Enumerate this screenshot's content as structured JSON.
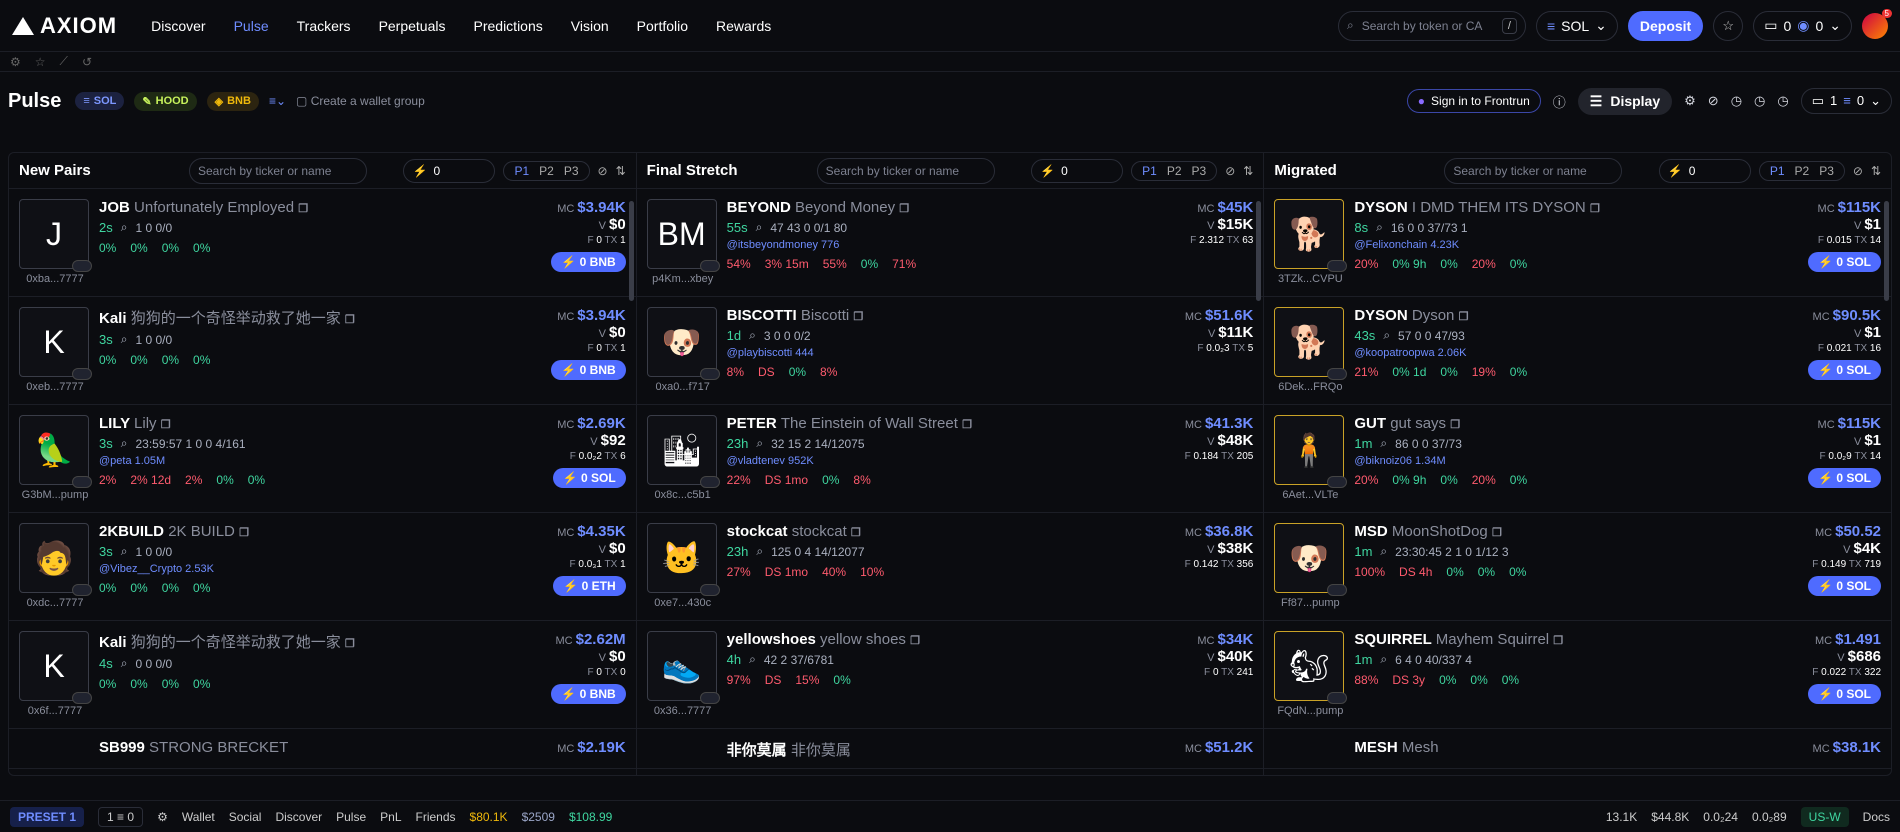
{
  "brand": "AXIOM",
  "nav": [
    "Discover",
    "Pulse",
    "Trackers",
    "Perpetuals",
    "Predictions",
    "Vision",
    "Portfolio",
    "Rewards"
  ],
  "search_placeholder": "Search by token or CA",
  "search_kbd": "/",
  "chain_select": "SOL",
  "deposit": "Deposit",
  "wallet_count": "0",
  "wallet_bal": "0",
  "avatar_badge": "5",
  "pulse": {
    "title": "Pulse",
    "chains": [
      "SOL",
      "HOOD",
      "BNB"
    ],
    "wallet_group": "Create a wallet group",
    "frontrun": "Sign in to Frontrun",
    "display": "Display",
    "wallet_pill_a": "1",
    "wallet_pill_b": "0"
  },
  "columns": [
    {
      "title": "New Pairs",
      "search": "Search by ticker or name",
      "zero": "0",
      "rows": [
        {
          "sym": "JOB",
          "name": "Unfortunately Employed",
          "age": "2s",
          "addr": "0xba...7777",
          "glyph": "J",
          "mc": "$3.94K",
          "v": "$0",
          "f": "0",
          "tx": "1",
          "buy": "0 BNB",
          "stats": [
            "0%",
            "0%",
            "0%",
            "0%"
          ],
          "extra": "1  0  0/0"
        },
        {
          "sym": "Kali",
          "name": "狗狗的一个奇怪举动救了她一家",
          "age": "3s",
          "addr": "0xeb...7777",
          "glyph": "K",
          "mc": "$3.94K",
          "v": "$0",
          "f": "0",
          "tx": "1",
          "buy": "0 BNB",
          "stats": [
            "0%",
            "0%",
            "0%",
            "0%"
          ],
          "extra": "1  0  0/0"
        },
        {
          "sym": "LILY",
          "name": "Lily",
          "age": "3s",
          "addr": "G3bM...pump",
          "glyph": "🦜",
          "mc": "$2.69K",
          "v": "$92",
          "f": "0.0₂2",
          "tx": "6",
          "buy": "0 SOL",
          "stats": [
            "2%",
            "2% 12d",
            "2%",
            "0%",
            "0%"
          ],
          "extra": "23:59:57  1  0  0  4/161",
          "handle": "@peta  1.05M"
        },
        {
          "sym": "2KBUILD",
          "name": "2K BUILD",
          "age": "3s",
          "addr": "0xdc...7777",
          "glyph": "🧑",
          "mc": "$4.35K",
          "v": "$0",
          "f": "0.0₃1",
          "tx": "1",
          "buy": "0 ETH",
          "stats": [
            "0%",
            "0%",
            "0%",
            "0%"
          ],
          "extra": "1  0  0/0",
          "handle": "@Vibez__Crypto  2.53K"
        },
        {
          "sym": "Kali",
          "name": "狗狗的一个奇怪举动救了她一家",
          "age": "4s",
          "addr": "0x6f...7777",
          "glyph": "K",
          "mc": "$2.62M",
          "v": "$0",
          "f": "0",
          "tx": "0",
          "buy": "0 BNB",
          "stats": [
            "0%",
            "0%",
            "0%",
            "0%"
          ],
          "extra": "0  0  0/0"
        }
      ]
    },
    {
      "title": "Final Stretch",
      "search": "Search by ticker or name",
      "zero": "0",
      "rows": [
        {
          "sym": "BEYOND",
          "name": "Beyond Money",
          "age": "55s",
          "addr": "p4Km...xbey",
          "glyph": "BM",
          "mc": "$45K",
          "v": "$15K",
          "f": "2.312",
          "tx": "63",
          "buy": "",
          "stats": [
            "54%",
            "3% 15m",
            "55%",
            "0%",
            "71%"
          ],
          "extra": "47  43  0  0/1  80",
          "handle": "@itsbeyondmoney  776"
        },
        {
          "sym": "BISCOTTI",
          "name": "Biscotti",
          "age": "1d",
          "addr": "0xa0...f717",
          "glyph": "🐶",
          "mc": "$51.6K",
          "v": "$11K",
          "f": "0.0₂3",
          "tx": "5",
          "buy": "",
          "stats": [
            "8%",
            "DS",
            "0%",
            "8%"
          ],
          "extra": "3  0  0  0/2",
          "handle": "@playbiscotti  444"
        },
        {
          "sym": "PETER",
          "name": "The Einstein of Wall Street",
          "age": "23h",
          "addr": "0x8c...c5b1",
          "glyph": "🏙",
          "mc": "$41.3K",
          "v": "$48K",
          "f": "0.184",
          "tx": "205",
          "buy": "",
          "stats": [
            "22%",
            "DS 1mo",
            "0%",
            "8%"
          ],
          "extra": "32  15  2  14/12075",
          "handle": "@vladtenev  952K"
        },
        {
          "sym": "stockcat",
          "name": "stockcat",
          "age": "23h",
          "addr": "0xe7...430c",
          "glyph": "🐱",
          "mc": "$36.8K",
          "v": "$38K",
          "f": "0.142",
          "tx": "356",
          "buy": "",
          "stats": [
            "27%",
            "DS 1mo",
            "40%",
            "10%"
          ],
          "extra": "125  0  4  14/12077"
        },
        {
          "sym": "yellowshoes",
          "name": "yellow shoes",
          "age": "4h",
          "addr": "0x36...7777",
          "glyph": "👟",
          "mc": "$34K",
          "v": "$40K",
          "f": "0",
          "tx": "241",
          "buy": "",
          "stats": [
            "97%",
            "DS",
            "15%",
            "0%"
          ],
          "extra": "42  2  37/6781"
        }
      ]
    },
    {
      "title": "Migrated",
      "search": "Search by ticker or name",
      "zero": "0",
      "rows": [
        {
          "sym": "DYSON",
          "name": "I DMD THEM ITS DYSON",
          "age": "8s",
          "addr": "3TZk...CVPU",
          "glyph": "🐕",
          "mc": "$115K",
          "v": "$1",
          "f": "0.015",
          "tx": "14",
          "buy": "0 SOL",
          "stats": [
            "20%",
            "0% 9h",
            "0%",
            "20%",
            "0%"
          ],
          "extra": "16  0  0  37/73  1",
          "handle": "@Felixonchain  4.23K"
        },
        {
          "sym": "DYSON",
          "name": "Dyson",
          "age": "43s",
          "addr": "6Dek...FRQo",
          "glyph": "🐕",
          "mc": "$90.5K",
          "v": "$1",
          "f": "0.021",
          "tx": "16",
          "buy": "0 SOL",
          "stats": [
            "21%",
            "0% 1d",
            "0%",
            "19%",
            "0%"
          ],
          "extra": "57  0  0  47/93",
          "handle": "@koopatroopwa  2.06K"
        },
        {
          "sym": "GUT",
          "name": "gut says",
          "age": "1m",
          "addr": "6Aet...VLTe",
          "glyph": "🧍",
          "mc": "$115K",
          "v": "$1",
          "f": "0.0₂9",
          "tx": "14",
          "buy": "0 SOL",
          "stats": [
            "20%",
            "0% 9h",
            "0%",
            "20%",
            "0%"
          ],
          "extra": "86  0  0  37/73",
          "handle": "@biknoiz06  1.34M"
        },
        {
          "sym": "MSD",
          "name": "MoonShotDog",
          "age": "1m",
          "addr": "Ff87...pump",
          "glyph": "🐶",
          "mc": "$50.52",
          "v": "$4K",
          "f": "0.149",
          "tx": "719",
          "buy": "0 SOL",
          "stats": [
            "100%",
            "DS 4h",
            "0%",
            "0%",
            "0%"
          ],
          "extra": "23:30:45  2  1  0  1/12  3"
        },
        {
          "sym": "SQUIRREL",
          "name": "Mayhem Squirrel",
          "age": "1m",
          "addr": "FQdN...pump",
          "glyph": "🐿",
          "mc": "$1.491",
          "v": "$686",
          "f": "0.022",
          "tx": "322",
          "buy": "0 SOL",
          "stats": [
            "88%",
            "DS 3y",
            "0%",
            "0%",
            "0%"
          ],
          "extra": "6  4  0  40/337  4"
        }
      ]
    }
  ],
  "peek": [
    {
      "sym": "SB999",
      "name": "STRONG BRECKET",
      "mc": "$2.19K"
    },
    {
      "sym": "非你莫属",
      "name": "非你莫属",
      "mc": "$51.2K"
    },
    {
      "sym": "MESH",
      "name": "Mesh",
      "mc": "$38.1K"
    }
  ],
  "footer": {
    "preset": "PRESET 1",
    "wallets": "1",
    "wbal": "0",
    "items": [
      "Wallet",
      "Social",
      "Discover",
      "Pulse",
      "PnL",
      "Friends"
    ],
    "btc": "$80.1K",
    "eth": "$2509",
    "sol": "$108.99",
    "stats": [
      "13.1K",
      "$44.8K",
      "0.0₂24",
      "0.0₂89"
    ],
    "region": "US-W",
    "docs": "Docs"
  }
}
